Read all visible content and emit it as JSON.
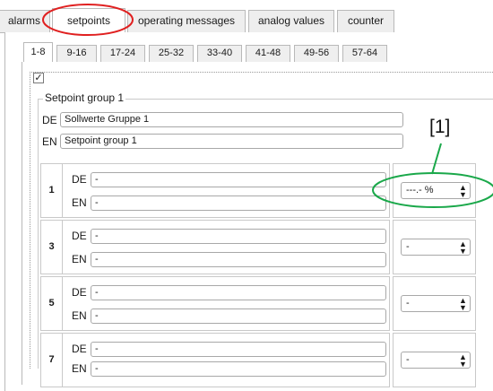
{
  "main_tabs": [
    {
      "label": "alarms",
      "active": false
    },
    {
      "label": "setpoints",
      "active": true
    },
    {
      "label": "operating messages",
      "active": false
    },
    {
      "label": "analog values",
      "active": false
    },
    {
      "label": "counter",
      "active": false
    }
  ],
  "sub_tabs": [
    {
      "label": "1-8",
      "active": true
    },
    {
      "label": "9-16",
      "active": false
    },
    {
      "label": "17-24",
      "active": false
    },
    {
      "label": "25-32",
      "active": false
    },
    {
      "label": "33-40",
      "active": false
    },
    {
      "label": "41-48",
      "active": false
    },
    {
      "label": "49-56",
      "active": false
    },
    {
      "label": "57-64",
      "active": false
    }
  ],
  "enabled_checked": true,
  "group": {
    "legend": "Setpoint group 1",
    "de_label": "DE",
    "de_value": "Sollwerte Gruppe 1",
    "en_label": "EN",
    "en_value": "Setpoint group 1"
  },
  "rows": [
    {
      "number": "1",
      "de_label": "DE",
      "de_value": "-",
      "en_label": "EN",
      "en_value": "-",
      "unit": "---.- %"
    },
    {
      "number": "3",
      "de_label": "DE",
      "de_value": "-",
      "en_label": "EN",
      "en_value": "-",
      "unit": "-"
    },
    {
      "number": "5",
      "de_label": "DE",
      "de_value": "-",
      "en_label": "EN",
      "en_value": "-",
      "unit": "-"
    },
    {
      "number": "7",
      "de_label": "DE",
      "de_value": "-",
      "en_label": "EN",
      "en_value": "-",
      "unit": "-"
    }
  ],
  "annotation": {
    "label": "[1]",
    "highlight_tab_color": "#e02020",
    "highlight_unit_color": "#1aa84a"
  },
  "icons": {
    "check": "checkmark-icon",
    "select_arrows": "up-down-arrows-icon"
  }
}
